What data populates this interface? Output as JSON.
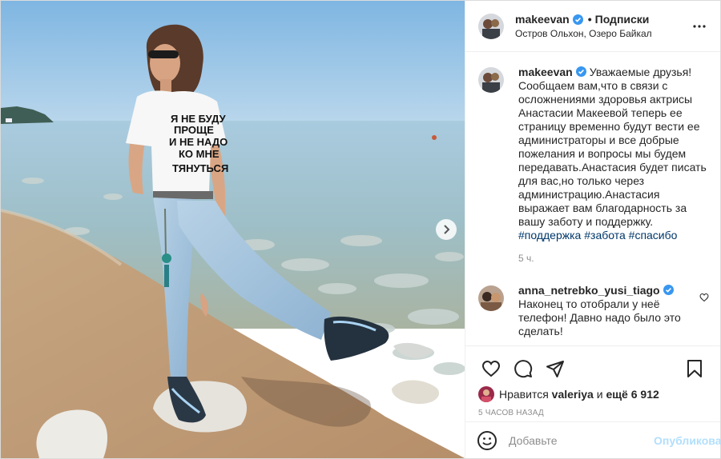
{
  "post": {
    "username": "makeevan",
    "follow_dot": "•",
    "follow_label": "Подписки",
    "location": "Остров Ольхон, Озеро Байкал"
  },
  "tshirt_text": [
    "Я НЕ БУДУ",
    "ПРОЩЕ",
    "И НЕ НАДО",
    "КО МНЕ",
    "ТЯНУТЬСЯ"
  ],
  "caption": {
    "username": "makeevan",
    "text": "Уважаемые друзья!\nСообщаем вам,что в связи с осложнениями здоровья актрисы Анастасии Макеевой теперь ее страницу временно будут вести ее администраторы и все добрые пожелания и вопросы мы будем передавать.Анастасия будет писать для вас,но только через администрацию.Анастасия выражает вам благодарность за вашу заботу и поддержку.",
    "tags": [
      "#поддержка",
      "#забота",
      "#спасибо"
    ],
    "time": "5 ч."
  },
  "comment": {
    "username": "anna_netrebko_yusi_tiago",
    "text": "Наконец то отобрали у неё телефон! Давно надо было это сделать!"
  },
  "likes": {
    "prefix": "Нравится",
    "user": "valeriya",
    "middle": "и",
    "count": "ещё 6 912"
  },
  "time_ago": "5 часов назад",
  "add_comment": {
    "placeholder": "Добавьте комментарий...",
    "shown": "Добавьте",
    "post_label": "Опубликовать"
  },
  "colors": {
    "verified": "#3897f0",
    "link": "#00376b",
    "muted": "#8e8e8e",
    "post_disabled": "#b2dffc"
  },
  "icons": [
    "verified-icon",
    "more-icon",
    "heart-icon",
    "comment-icon",
    "share-icon",
    "bookmark-icon",
    "emoji-icon",
    "chevron-right-icon"
  ]
}
